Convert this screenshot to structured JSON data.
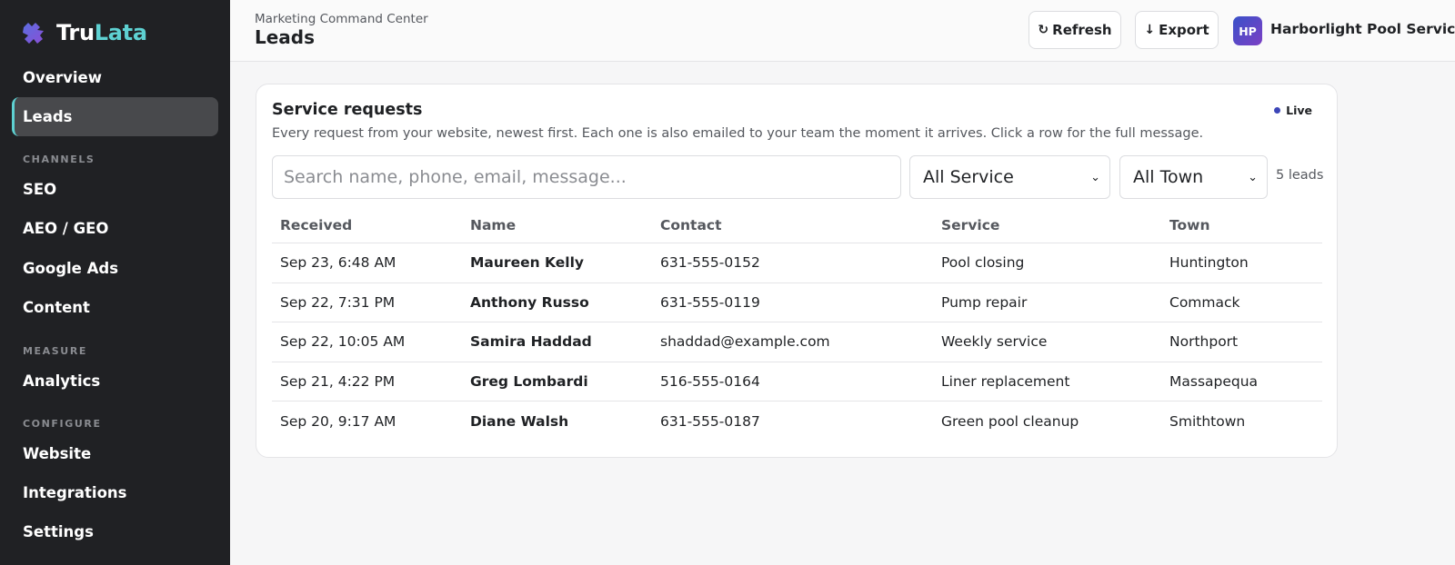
{
  "brand": {
    "name_part1": "Tru",
    "name_part2": "Lata",
    "logo_icon": "puzzle-logo"
  },
  "sidebar": {
    "items_top": [
      {
        "label": "Overview",
        "active": false
      },
      {
        "label": "Leads",
        "active": true
      }
    ],
    "sections": [
      {
        "title": "CHANNELS",
        "items": [
          "SEO",
          "AEO / GEO",
          "Google Ads",
          "Content"
        ]
      },
      {
        "title": "MEASURE",
        "items": [
          "Analytics"
        ]
      },
      {
        "title": "CONFIGURE",
        "items": [
          "Website",
          "Integrations",
          "Settings"
        ]
      }
    ]
  },
  "header": {
    "breadcrumb": "Marketing Command Center",
    "title": "Leads",
    "refresh_label": "Refresh",
    "export_label": "Export",
    "avatar_initials": "HP",
    "account_name": "Harborlight Pool Service"
  },
  "card": {
    "title": "Service requests",
    "live_label": "Live",
    "subtitle": "Every request from your website, newest first. Each one is also emailed to your team the moment it arrives. Click a row for the full message.",
    "search_placeholder": "Search name, phone, email, message...",
    "service_filter": "All Service",
    "town_filter": "All Town",
    "lead_count": "5 leads"
  },
  "table": {
    "columns": [
      "Received",
      "Name",
      "Contact",
      "Service",
      "Town"
    ],
    "rows": [
      {
        "received": "Sep 23, 6:48 AM",
        "name": "Maureen Kelly",
        "contact": "631-555-0152",
        "service": "Pool closing",
        "town": "Huntington"
      },
      {
        "received": "Sep 22, 7:31 PM",
        "name": "Anthony Russo",
        "contact": "631-555-0119",
        "service": "Pump repair",
        "town": "Commack"
      },
      {
        "received": "Sep 22, 10:05 AM",
        "name": "Samira Haddad",
        "contact": "shaddad@example.com",
        "service": "Weekly service",
        "town": "Northport"
      },
      {
        "received": "Sep 21, 4:22 PM",
        "name": "Greg Lombardi",
        "contact": "516-555-0164",
        "service": "Liner replacement",
        "town": "Massapequa"
      },
      {
        "received": "Sep 20, 9:17 AM",
        "name": "Diane Walsh",
        "contact": "631-555-0187",
        "service": "Green pool cleanup",
        "town": "Smithtown"
      }
    ]
  },
  "colors": {
    "sidebar_bg": "#202124",
    "accent": "#5ed1d2",
    "live_dot": "#3c46b8"
  }
}
